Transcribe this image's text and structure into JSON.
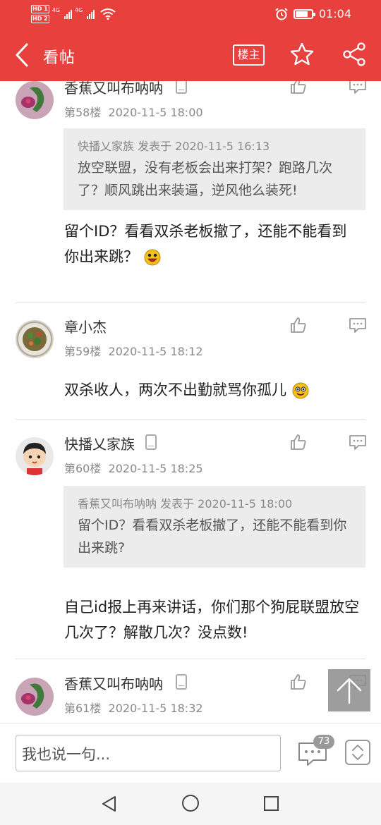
{
  "status_bar": {
    "sim1": "HD 1",
    "sim2": "HD 2",
    "network1": "4G",
    "network2": "4G",
    "time": "01:04",
    "battery_level": 0.8
  },
  "header": {
    "back_icon": "chevron-left-icon",
    "title": "看帖",
    "louzhu_label": "楼主",
    "favorite_icon": "star-outline-icon",
    "share_icon": "share-icon",
    "bg_color": "#e8403c"
  },
  "posts": [
    {
      "username": "香蕉又叫布呐呐",
      "floor": "第58楼",
      "time": "2020-11-5 18:00",
      "quote_header": "快播乂家族 发表于 2020-11-5 16:13",
      "quote_body": "放空联盟，没有老板会出来打架？跑路几次了？顺风跳出来装逼，逆风他么装死!",
      "text": "留个ID？看看双杀老板撤了，还能不能看到你出来跳？",
      "emoji": "grin-emoji"
    },
    {
      "username": "章小杰",
      "floor": "第59楼",
      "time": "2020-11-5 18:12",
      "text": "双杀收人，两次不出勤就骂你孤儿",
      "emoji": "grin-emoji"
    },
    {
      "username": "快播乂家族",
      "floor": "第60楼",
      "time": "2020-11-5 18:25",
      "quote_header": "香蕉又叫布呐呐 发表于 2020-11-5 18:00",
      "quote_body": "留个ID？看看双杀老板撤了，还能不能看到你出来跳?",
      "text": "自己id报上再来讲话，你们那个狗屁联盟放空几次了？解散几次？没点数!"
    },
    {
      "username": "香蕉又叫布呐呐",
      "floor": "第61楼",
      "time": "2020-11-5 18:32"
    }
  ],
  "bottom_bar": {
    "input_placeholder": "我也说一句...",
    "comment_count": "73",
    "comment_icon": "comment-icon",
    "scroll_icon": "up-down-chevron-icon",
    "to_top_icon": "arrow-up-icon"
  },
  "nav_bar": {
    "back_icon": "triangle-back-icon",
    "home_icon": "circle-home-icon",
    "recent_icon": "square-recent-icon"
  }
}
